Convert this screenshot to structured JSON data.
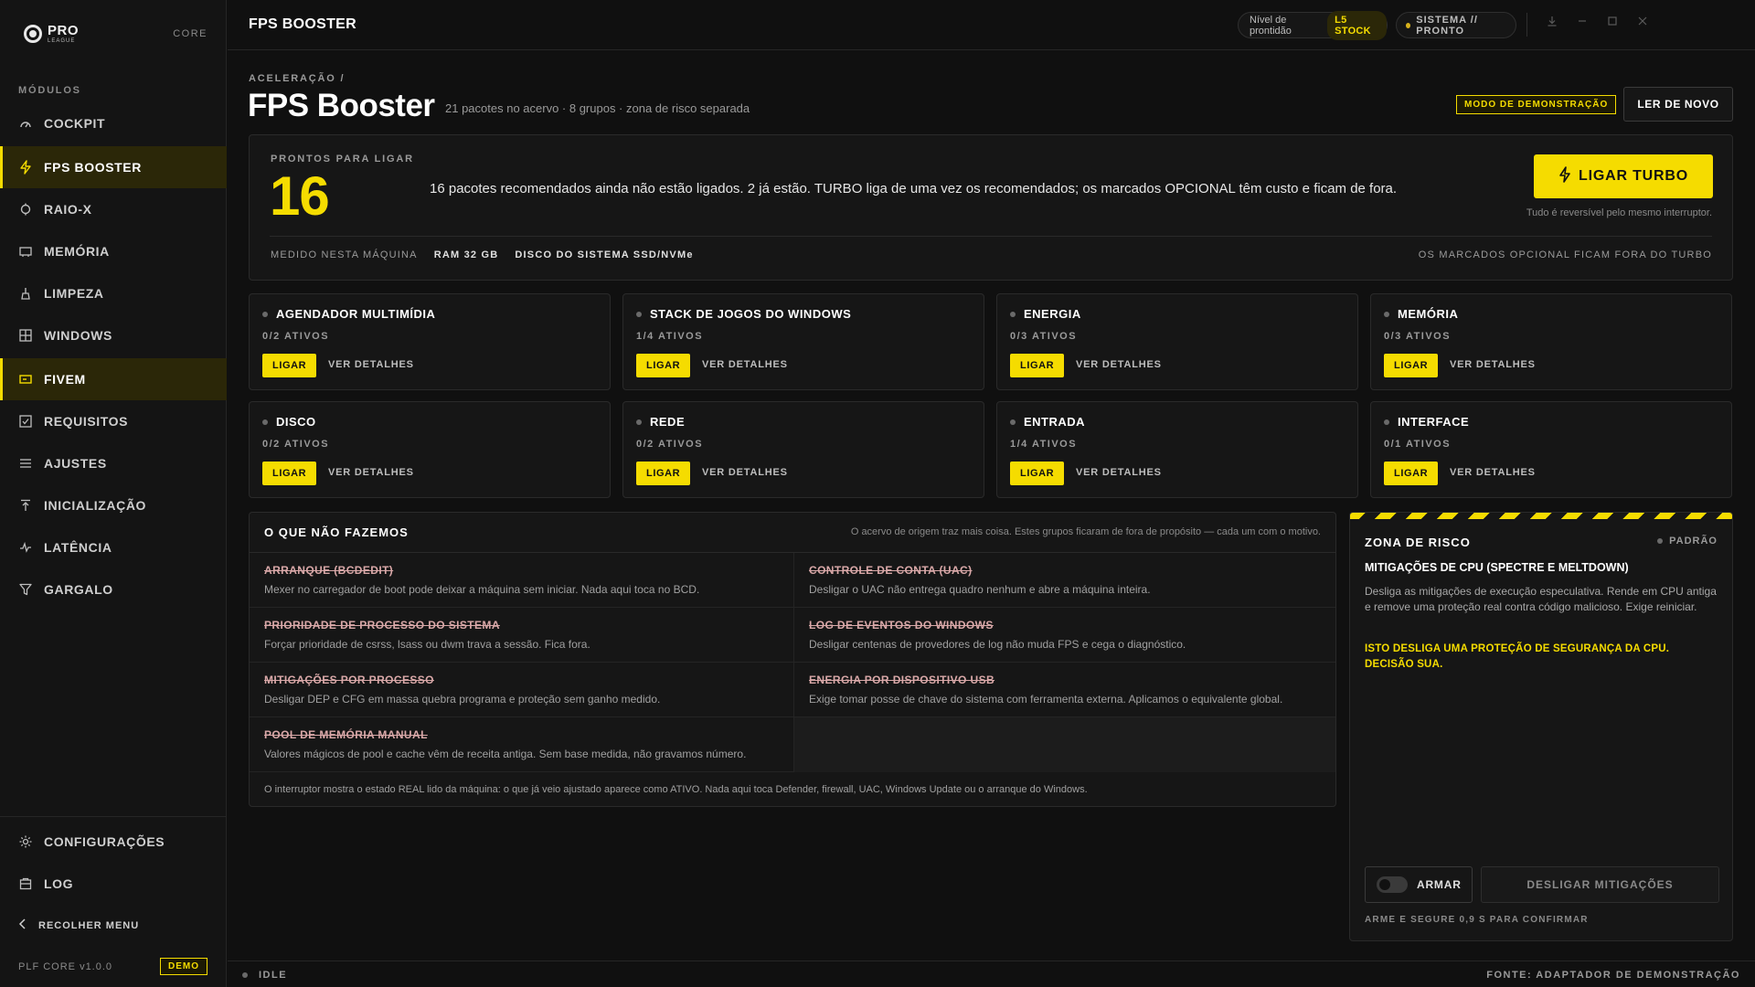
{
  "sidebar": {
    "brand_big": "PRO",
    "brand_small": "LEAGUE",
    "core_label": "CORE",
    "modules_title": "MÓDULOS",
    "items": [
      {
        "label": "COCKPIT",
        "icon": "gauge-icon"
      },
      {
        "label": "FPS BOOSTER",
        "icon": "bolt-icon",
        "active": true
      },
      {
        "label": "RAIO-X",
        "icon": "crosshair-icon"
      },
      {
        "label": "MEMÓRIA",
        "icon": "memory-icon"
      },
      {
        "label": "LIMPEZA",
        "icon": "broom-icon"
      },
      {
        "label": "WINDOWS",
        "icon": "windows-grid-icon"
      },
      {
        "label": "FIVEM",
        "icon": "gamepad-icon",
        "active": true
      },
      {
        "label": "REQUISITOS",
        "icon": "checkbox-icon"
      },
      {
        "label": "AJUSTES",
        "icon": "sliders-icon"
      },
      {
        "label": "INICIALIZAÇÃO",
        "icon": "upload-icon"
      },
      {
        "label": "LATÊNCIA",
        "icon": "pulse-icon"
      },
      {
        "label": "GARGALO",
        "icon": "funnel-icon"
      }
    ],
    "bottom": [
      {
        "label": "CONFIGURAÇÕES",
        "icon": "gear-icon"
      },
      {
        "label": "LOG",
        "icon": "log-icon"
      }
    ],
    "collapse_label": "RECOLHER MENU",
    "version": "PLF CORE v1.0.0",
    "demo_badge": "DEMO"
  },
  "topbar": {
    "title": "FPS BOOSTER",
    "readiness_label": "Nível de prontidão",
    "readiness_level": "L5 STOCK",
    "system_status": "SISTEMA // PRONTO",
    "accent_color": "#f5dc00"
  },
  "header": {
    "breadcrumb": "ACELERAÇÃO /",
    "title": "FPS Booster",
    "subtitle": "21 pacotes no acervo · 8 grupos · zona de risco separada",
    "demo_mode": "MODO DE DEMONSTRAÇÃO",
    "reread_button": "LER DE NOVO"
  },
  "ready": {
    "label": "PRONTOS PARA LIGAR",
    "count": "16",
    "message": "16 pacotes recomendados ainda não estão ligados. 2 já estão. TURBO liga de uma vez os recomendados; os marcados OPCIONAL têm custo e ficam de fora.",
    "turbo_button": "LIGAR TURBO",
    "turbo_note": "Tudo é reversível pelo mesmo interruptor.",
    "measured_label": "MEDIDO NESTA MÁQUINA",
    "ram": "RAM 32 GB",
    "disk": "DISCO DO SISTEMA SSD/NVMe",
    "optional_note": "OS MARCADOS OPCIONAL FICAM FORA DO TURBO"
  },
  "groups": [
    {
      "name": "AGENDADOR MULTIMÍDIA",
      "count": "0/2 ATIVOS",
      "on": "LIGAR",
      "details": "VER DETALHES"
    },
    {
      "name": "STACK DE JOGOS DO WINDOWS",
      "count": "1/4 ATIVOS",
      "on": "LIGAR",
      "details": "VER DETALHES"
    },
    {
      "name": "ENERGIA",
      "count": "0/3 ATIVOS",
      "on": "LIGAR",
      "details": "VER DETALHES"
    },
    {
      "name": "MEMÓRIA",
      "count": "0/3 ATIVOS",
      "on": "LIGAR",
      "details": "VER DETALHES"
    },
    {
      "name": "DISCO",
      "count": "0/2 ATIVOS",
      "on": "LIGAR",
      "details": "VER DETALHES"
    },
    {
      "name": "REDE",
      "count": "0/2 ATIVOS",
      "on": "LIGAR",
      "details": "VER DETALHES"
    },
    {
      "name": "ENTRADA",
      "count": "1/4 ATIVOS",
      "on": "LIGAR",
      "details": "VER DETALHES"
    },
    {
      "name": "INTERFACE",
      "count": "0/1 ATIVOS",
      "on": "LIGAR",
      "details": "VER DETALHES"
    }
  ],
  "not_doing": {
    "title": "O QUE NÃO FAZEMOS",
    "note": "O acervo de origem traz mais coisa. Estes grupos ficaram de fora de propósito — cada um com o motivo.",
    "items": [
      {
        "title": "ARRANQUE (BCDEDIT)",
        "desc": "Mexer no carregador de boot pode deixar a máquina sem iniciar. Nada aqui toca no BCD."
      },
      {
        "title": "CONTROLE DE CONTA (UAC)",
        "desc": "Desligar o UAC não entrega quadro nenhum e abre a máquina inteira."
      },
      {
        "title": "PRIORIDADE DE PROCESSO DO SISTEMA",
        "desc": "Forçar prioridade de csrss, lsass ou dwm trava a sessão. Fica fora."
      },
      {
        "title": "LOG DE EVENTOS DO WINDOWS",
        "desc": "Desligar centenas de provedores de log não muda FPS e cega o diagnóstico."
      },
      {
        "title": "MITIGAÇÕES POR PROCESSO",
        "desc": "Desligar DEP e CFG em massa quebra programa e proteção sem ganho medido."
      },
      {
        "title": "ENERGIA POR DISPOSITIVO USB",
        "desc": "Exige tomar posse de chave do sistema com ferramenta externa. Aplicamos o equivalente global."
      },
      {
        "title": "POOL DE MEMÓRIA MANUAL",
        "desc": "Valores mágicos de pool e cache vêm de receita antiga. Sem base medida, não gravamos número."
      }
    ],
    "footer": "O interruptor mostra o estado REAL lido da máquina: o que já veio ajustado aparece como ATIVO. Nada aqui toca Defender, firewall, UAC, Windows Update ou o arranque do Windows."
  },
  "risk": {
    "title": "ZONA DE RISCO",
    "state": "PADRÃO",
    "subtitle": "MITIGAÇÕES DE CPU (SPECTRE E MELTDOWN)",
    "description": "Desliga as mitigações de execução especulativa. Rende em CPU antiga e remove uma proteção real contra código malicioso. Exige reiniciar.",
    "warning": "ISTO DESLIGA UMA PROTEÇÃO DE SEGURANÇA DA CPU. DECISÃO SUA.",
    "arm_label": "ARMAR",
    "disable_button": "DESLIGAR MITIGAÇÕES",
    "arm_note": "ARME E SEGURE 0,9 S PARA CONFIRMAR"
  },
  "statusbar": {
    "state": "IDLE",
    "source": "FONTE: ADAPTADOR DE DEMONSTRAÇÃO"
  }
}
